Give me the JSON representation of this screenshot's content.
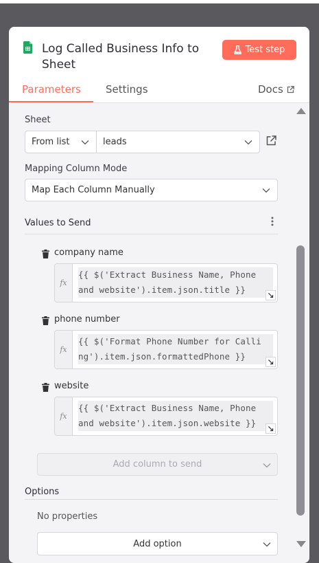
{
  "header": {
    "title": "Log Called Business Info to Sheet",
    "test_button": "Test step",
    "tabs": [
      {
        "label": "Parameters",
        "active": true
      },
      {
        "label": "Settings",
        "active": false
      }
    ],
    "docs_label": "Docs"
  },
  "sheet": {
    "label": "Sheet",
    "mode": "From list",
    "value": "leads"
  },
  "mapping": {
    "label": "Mapping Column Mode",
    "value": "Map Each Column Manually"
  },
  "values": {
    "heading": "Values to Send",
    "fields": [
      {
        "name": "company name",
        "lines": [
          "{{ $('Extract Business Name, Phone ",
          "and website').item.json.title }}"
        ]
      },
      {
        "name": "phone number",
        "lines": [
          "{{ $('Format Phone Number for Calli",
          "ng').item.json.formattedPhone }}"
        ]
      },
      {
        "name": "website",
        "lines": [
          "{{ $('Extract Business Name, Phone ",
          "and website').item.json.website }}"
        ]
      }
    ],
    "add_column_label": "Add column to send"
  },
  "options": {
    "heading": "Options",
    "empty_text": "No properties",
    "add_option_label": "Add option"
  },
  "colors": {
    "accent": "#ff6d5a",
    "sheets_green": "#23a566"
  }
}
